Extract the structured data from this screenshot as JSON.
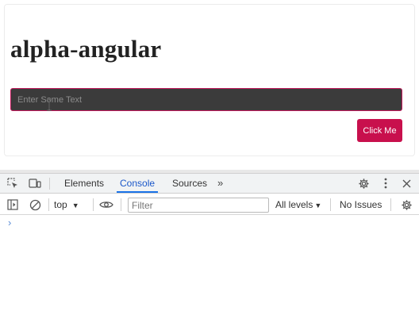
{
  "page": {
    "title": "alpha-angular",
    "input_placeholder": "Enter Some Text",
    "input_value": "",
    "button_label": "Click Me",
    "colors": {
      "accent": "#c8104d",
      "input_bg": "#3b3b3b"
    }
  },
  "devtools": {
    "tabs": [
      {
        "label": "Elements",
        "active": false
      },
      {
        "label": "Console",
        "active": true
      },
      {
        "label": "Sources",
        "active": false
      }
    ],
    "more_tabs_glyph": "»",
    "toolbar": {
      "context": "top",
      "filter_placeholder": "Filter",
      "levels": "All levels",
      "issues": "No Issues"
    },
    "prompt_glyph": "›",
    "icons": [
      "inspect-element-icon",
      "device-toggle-icon",
      "settings-gear-icon",
      "more-vertical-icon",
      "close-icon",
      "sidebar-toggle-icon",
      "clear-console-icon",
      "live-expression-eye-icon",
      "console-settings-icon"
    ]
  }
}
